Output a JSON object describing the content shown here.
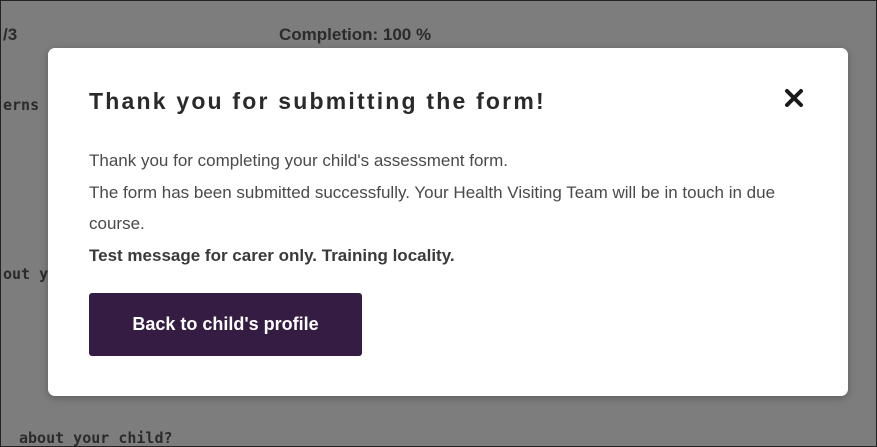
{
  "background": {
    "step_text": "/3",
    "completion_label": "Completion:",
    "completion_value": "100 %",
    "label_a": "erns",
    "label_b": "out y",
    "label_c": "about your child?"
  },
  "modal": {
    "title": "Thank you for submitting the form!",
    "close_icon": "close-icon",
    "body_line_1": "Thank you for completing your child's assessment form.",
    "body_line_2": "The form has been submitted successfully. Your Health Visiting Team will be in touch in due course.",
    "body_line_3": "Test message for carer only. Training locality.",
    "primary_button_label": "Back to child's profile"
  },
  "colors": {
    "overlay": "#7d7d7d",
    "primary_button": "#351c42",
    "text_dark": "#2a2a2a",
    "text_body": "#4a4a4a"
  }
}
